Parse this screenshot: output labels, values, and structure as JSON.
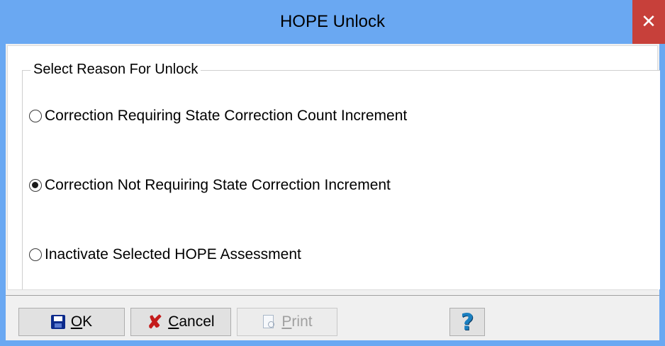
{
  "window": {
    "title": "HOPE Unlock",
    "close_symbol": "✕",
    "titlebar_color": "#6aa8f2",
    "close_color": "#c7403a"
  },
  "groupbox": {
    "legend": "Select Reason For Unlock",
    "options": [
      {
        "label": "Correction Requiring State Correction Count Increment",
        "checked": false
      },
      {
        "label": "Correction Not Requiring State Correction Increment",
        "checked": true
      },
      {
        "label": "Inactivate Selected HOPE Assessment",
        "checked": false
      }
    ]
  },
  "buttons": {
    "ok": {
      "mnemonic": "O",
      "rest": "K",
      "icon": "save-icon"
    },
    "cancel": {
      "mnemonic": "C",
      "rest": "ancel",
      "icon": "cancel-icon",
      "glyph": "✘"
    },
    "print": {
      "mnemonic": "P",
      "rest": "rint",
      "icon": "print-icon",
      "enabled": false
    },
    "help": {
      "glyph": "?",
      "icon": "help-icon"
    }
  }
}
